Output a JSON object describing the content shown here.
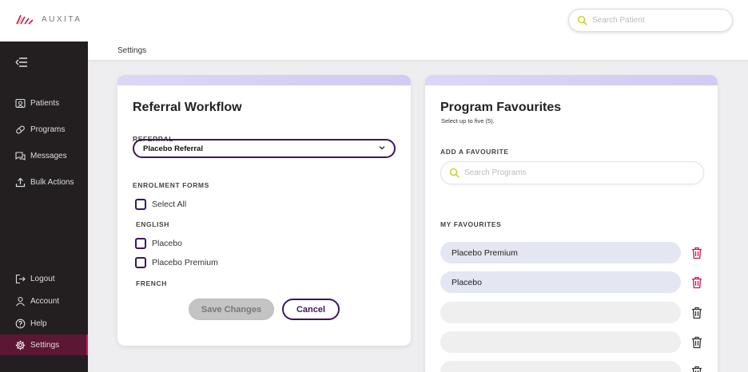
{
  "brand": {
    "name": "AUXITA"
  },
  "header": {
    "search_placeholder": "Search Patient"
  },
  "sidebar": {
    "items": [
      {
        "label": "Patients",
        "icon": "patients-icon"
      },
      {
        "label": "Programs",
        "icon": "programs-icon"
      },
      {
        "label": "Messages",
        "icon": "messages-icon"
      },
      {
        "label": "Bulk Actions",
        "icon": "bulk-actions-icon"
      }
    ],
    "bottom": [
      {
        "label": "Logout",
        "icon": "logout-icon"
      },
      {
        "label": "Account",
        "icon": "account-icon"
      },
      {
        "label": "Help",
        "icon": "help-icon"
      },
      {
        "label": "Settings",
        "icon": "settings-icon",
        "active": true
      }
    ]
  },
  "breadcrumb": "Settings",
  "referral_card": {
    "title": "Referral Workflow",
    "referral_label": "REFERRAL",
    "referral_value": "Placebo Referral",
    "enrolment_label": "ENROLMENT FORMS",
    "select_all": "Select All",
    "english_label": "ENGLISH",
    "forms": [
      "Placebo",
      "Placebo Premium"
    ],
    "french_label": "FRENCH",
    "save_label": "Save Changes",
    "cancel_label": "Cancel"
  },
  "favourites_card": {
    "title": "Program Favourites",
    "subtitle": "Select up to five (5).",
    "add_label": "ADD A FAVOURITE",
    "search_placeholder": "Search Programs",
    "my_label": "MY FAVOURITES",
    "favourites": [
      "Placebo Premium",
      "Placebo",
      "",
      "",
      ""
    ]
  },
  "colors": {
    "accent": "#3b1660",
    "active_nav": "#5b1734",
    "delete_red": "#c2185b",
    "search_icon": "#c8d13a"
  }
}
